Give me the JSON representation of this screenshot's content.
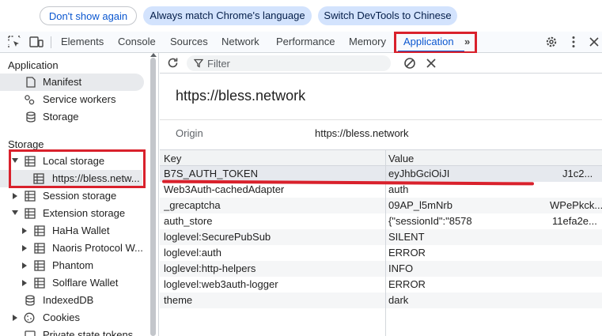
{
  "banner": {
    "dont_show": "Don't show again",
    "match_language": "Always match Chrome's language",
    "switch_chinese": "Switch DevTools to Chinese"
  },
  "tabs": {
    "items": [
      "Elements",
      "Console",
      "Sources",
      "Network",
      "Performance",
      "Memory",
      "Application"
    ],
    "active": "Application",
    "more": "»"
  },
  "sidebar": {
    "application_title": "Application",
    "application_items": [
      "Manifest",
      "Service workers",
      "Storage"
    ],
    "storage_title": "Storage",
    "local_storage": "Local storage",
    "local_storage_child": "https://bless.netw...",
    "session_storage": "Session storage",
    "extension_storage": "Extension storage",
    "extension_children": [
      "HaHa Wallet",
      "Naoris Protocol W...",
      "Phantom",
      "Solflare Wallet"
    ],
    "indexeddb": "IndexedDB",
    "cookies": "Cookies",
    "private_state_tokens": "Private state tokens"
  },
  "pane": {
    "filter_placeholder": "Filter",
    "origin_title": "https://bless.network",
    "origin_label": "Origin",
    "origin_value": "https://bless.network",
    "columns": {
      "key": "Key",
      "value": "Value"
    },
    "rows": [
      {
        "key": "B7S_AUTH_TOKEN",
        "value": "eyJhbGciOiJI",
        "value_tail": "J1c2..."
      },
      {
        "key": "Web3Auth-cachedAdapter",
        "value": "auth",
        "value_tail": ""
      },
      {
        "key": "_grecaptcha",
        "value": "09AP_l5mNrb",
        "value_tail": "WPePkck..."
      },
      {
        "key": "auth_store",
        "value": "{\"sessionId\":\"8578",
        "value_tail": "11efa2e..."
      },
      {
        "key": "loglevel:SecurePubSub",
        "value": "SILENT",
        "value_tail": ""
      },
      {
        "key": "loglevel:auth",
        "value": "ERROR",
        "value_tail": ""
      },
      {
        "key": "loglevel:http-helpers",
        "value": "INFO",
        "value_tail": ""
      },
      {
        "key": "loglevel:web3auth-logger",
        "value": "ERROR",
        "value_tail": ""
      },
      {
        "key": "theme",
        "value": "dark",
        "value_tail": ""
      }
    ]
  },
  "colors": {
    "accent": "#0b57d0",
    "highlight_red": "#d9212c",
    "pill_fill": "#d3e3fd"
  }
}
